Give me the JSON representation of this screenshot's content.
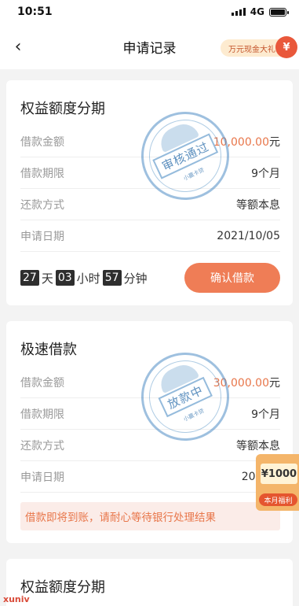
{
  "status_bar": {
    "time": "10:51",
    "network": "4G"
  },
  "nav": {
    "title": "申请记录",
    "promo_label": "万元现金大礼",
    "promo_icon": "gift-bag-icon"
  },
  "cards": [
    {
      "title": "权益额度分期",
      "rows": [
        {
          "label": "借款金额",
          "value": "10,000.00",
          "unit": "元"
        },
        {
          "label": "借款期限",
          "value": "9个月"
        },
        {
          "label": "还款方式",
          "value": "等额本息"
        },
        {
          "label": "申请日期",
          "value": "2021/10/05"
        }
      ],
      "stamp_text": "审核通过",
      "stamp_sub": "小赢卡贷",
      "countdown": {
        "days": "27",
        "days_unit": "天",
        "hours": "03",
        "hours_unit": "小时",
        "minutes": "57",
        "minutes_unit": "分钟"
      },
      "button_label": "确认借款"
    },
    {
      "title": "极速借款",
      "rows": [
        {
          "label": "借款金额",
          "value": "30,000.00",
          "unit": "元"
        },
        {
          "label": "借款期限",
          "value": "9个月"
        },
        {
          "label": "还款方式",
          "value": "等额本息"
        },
        {
          "label": "申请日期",
          "value": "2021/1"
        }
      ],
      "stamp_text": "放款中",
      "stamp_sub": "小赢卡贷",
      "notice": "借款即将到账，请耐心等待银行处理结果"
    },
    {
      "title": "权益额度分期"
    }
  ],
  "floating_promo": {
    "amount": "¥1000",
    "tag": "本月福利"
  },
  "watermark": "xuniv",
  "colors": {
    "accent": "#ef7d56",
    "amount": "#e8764a",
    "stamp": "#4e8dc4",
    "background": "#f3f3f3"
  }
}
